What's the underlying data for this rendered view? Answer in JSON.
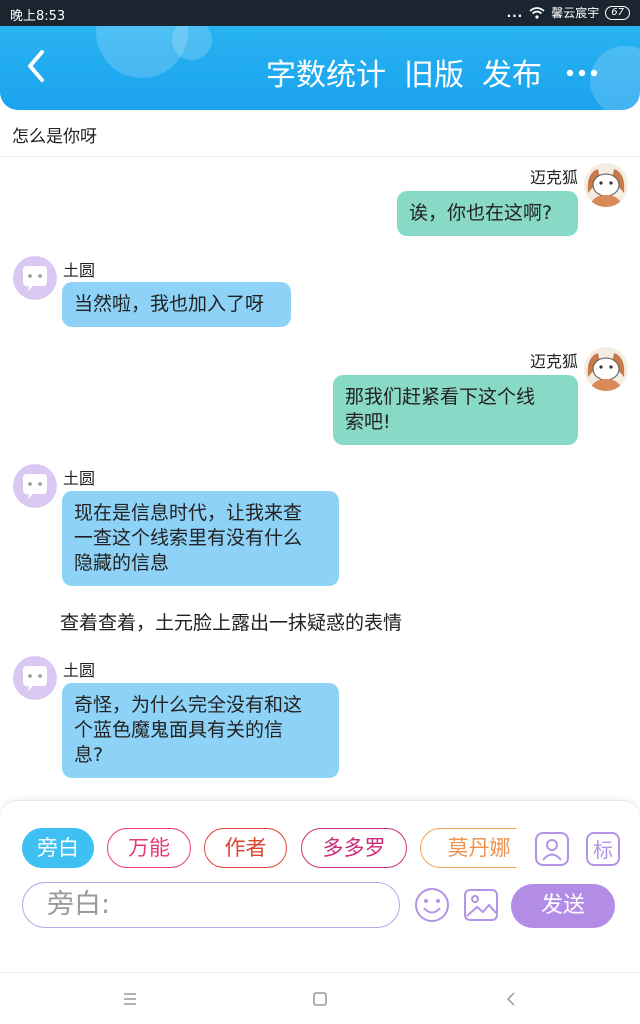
{
  "status_bar": {
    "time": "晚上8:53",
    "dots": "...",
    "carrier": "馨云宸宇",
    "battery": "67"
  },
  "header": {
    "back_icon": "chevron-left-icon",
    "actions": [
      "字数统计",
      "旧版",
      "发布"
    ],
    "more_icon": "more-dots-icon",
    "bg_color": "#1aa3ee"
  },
  "scene_title": "怎么是你呀",
  "messages": [
    {
      "speaker": "迈克狐",
      "side": "right",
      "text": "诶，你也在这啊?"
    },
    {
      "speaker": "土圆",
      "side": "left",
      "text": "当然啦，我也加入了呀"
    },
    {
      "speaker": "迈克狐",
      "side": "right",
      "line1": "那我们赶紧看下这个线",
      "line2": "索吧!"
    },
    {
      "speaker": "土圆",
      "side": "left",
      "line1": "现在是信息时代，让我来查",
      "line2": "一查这个线索里有没有什么",
      "line3": "隐藏的信息"
    },
    {
      "speaker": "土圆",
      "side": "left",
      "line1": "奇怪，为什么完全没有和这",
      "line2": "个蓝色魔鬼面具有关的信",
      "line3": "息?"
    }
  ],
  "narration": "查着查着，土元脸上露出一抹疑惑的表情",
  "input_panel": {
    "roles": [
      "旁白",
      "万能",
      "作者",
      "多多罗",
      "莫丹娜"
    ],
    "role_icons": [
      "contact-card-icon",
      "tag-label-icon"
    ],
    "role_tag_label": "标",
    "placeholder": "旁白:",
    "tool_icons": [
      "emoji-icon",
      "image-icon"
    ],
    "send_label": "发送"
  },
  "nav_bar": {
    "icons": [
      "menu-icon",
      "home-icon",
      "back-icon"
    ]
  },
  "colors": {
    "right_bubble": "#89d9c7",
    "left_bubble": "#8ed3f7",
    "send_button": "#b38ce6",
    "active_role": "#3ec0f2"
  }
}
